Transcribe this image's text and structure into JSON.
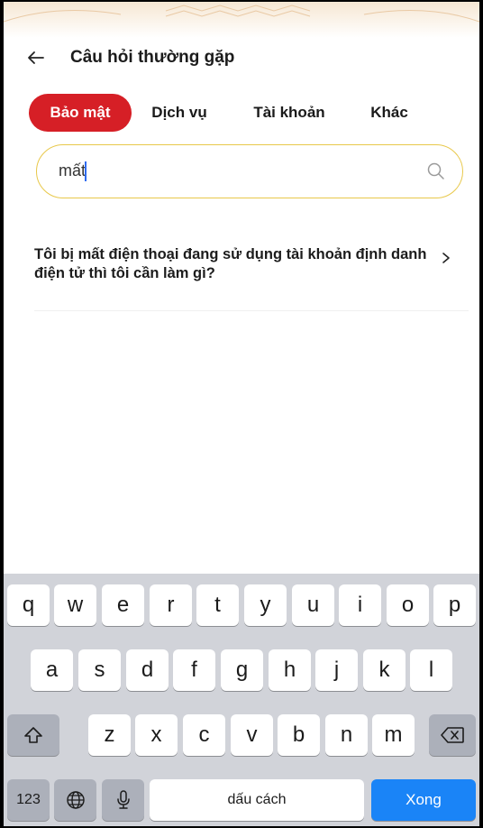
{
  "header": {
    "title": "Câu hỏi thường gặp",
    "back_icon": "arrow-left-icon"
  },
  "tabs": [
    {
      "label": "Bảo mật",
      "active": true
    },
    {
      "label": "Dịch vụ",
      "active": false
    },
    {
      "label": "Tài khoản",
      "active": false
    },
    {
      "label": "Khác",
      "active": false
    }
  ],
  "search": {
    "value": "mất",
    "icon": "search-icon"
  },
  "results": [
    {
      "question": "Tôi bị mất điện thoại đang sử dụng tài khoản định danh điện tử thì tôi cần làm gì?"
    }
  ],
  "keyboard": {
    "row1": [
      "q",
      "w",
      "e",
      "r",
      "t",
      "y",
      "u",
      "i",
      "o",
      "p"
    ],
    "row2": [
      "a",
      "s",
      "d",
      "f",
      "g",
      "h",
      "j",
      "k",
      "l"
    ],
    "row3": [
      "z",
      "x",
      "c",
      "v",
      "b",
      "n",
      "m"
    ],
    "numbers_label": "123",
    "space_label": "dấu cách",
    "done_label": "Xong"
  },
  "colors": {
    "accent": "#d61f26",
    "search_border": "#e8c84a",
    "done_key": "#1a84f7"
  }
}
